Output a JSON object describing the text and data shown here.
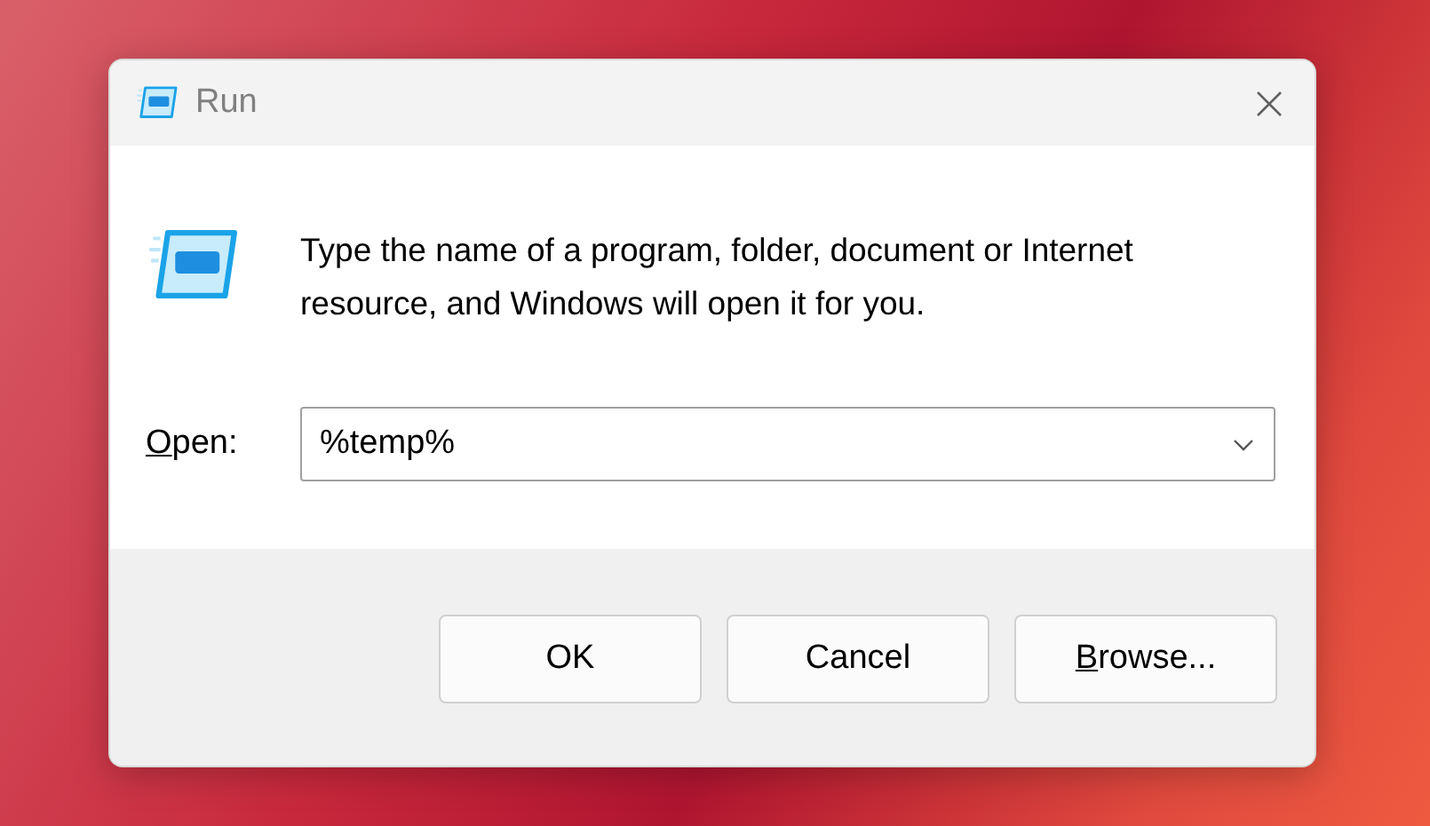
{
  "window": {
    "title": "Run"
  },
  "message": "Type the name of a program, folder, document or Internet resource, and Windows will open it for you.",
  "open_field": {
    "label": "Open:",
    "label_first_letter_underlined": true,
    "value": "%temp%"
  },
  "buttons": [
    {
      "label": "OK",
      "first_letter_underlined": false
    },
    {
      "label": "Cancel",
      "first_letter_underlined": false
    },
    {
      "label": "Browse...",
      "first_letter_underlined": true
    }
  ]
}
